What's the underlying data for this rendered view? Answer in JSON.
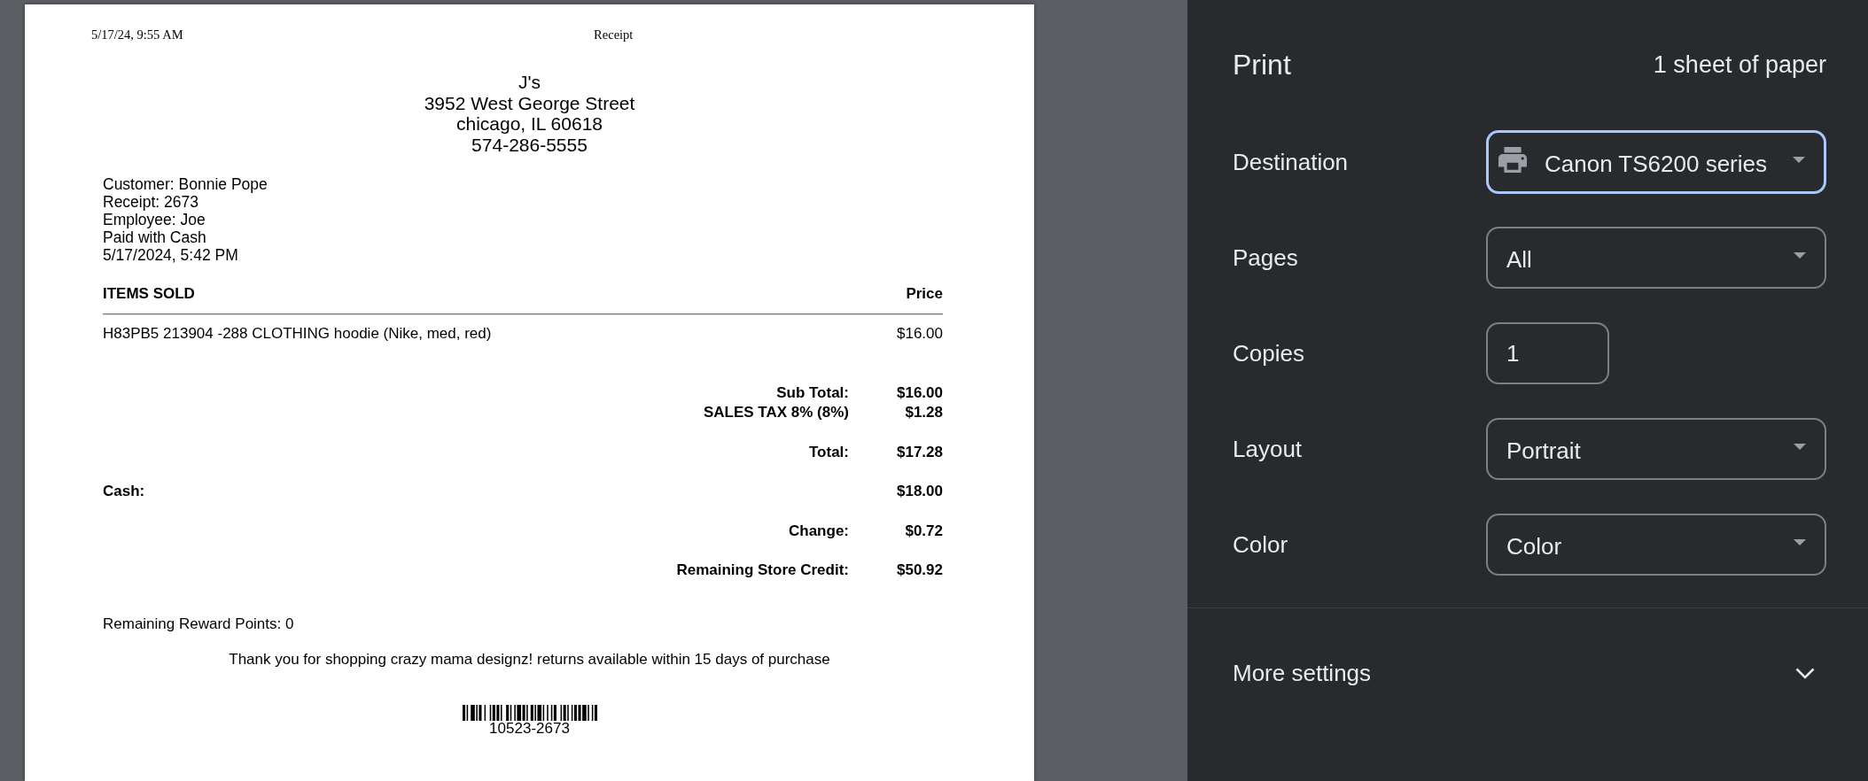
{
  "preview": {
    "page_header": {
      "date": "5/17/24, 9:55 AM",
      "title": "Receipt"
    },
    "store": {
      "name": "J's",
      "address_lines": [
        "3952 West George Street",
        "chicago, IL 60618"
      ],
      "phone": "574-286-5555"
    },
    "customer_details": [
      "Customer: Bonnie Pope",
      "Receipt: 2673",
      "Employee: Joe",
      "Paid with Cash",
      "5/17/2024, 5:42 PM"
    ],
    "items_table": {
      "columns": [
        "ITEMS SOLD",
        "Price"
      ],
      "rows": [
        {
          "description": "H83PB5 213904 -288 CLOTHING hoodie (Nike, med, red)",
          "price": "$16.00"
        }
      ]
    },
    "totals": [
      {
        "lines": [
          {
            "label": "Sub Total:",
            "value": "$16.00",
            "kind": "summary"
          },
          {
            "label": "SALES TAX 8% (8%)",
            "value": "$1.28",
            "kind": "summary"
          }
        ]
      },
      {
        "lines": [
          {
            "label": "Total:",
            "value": "$17.28",
            "kind": "summary"
          }
        ]
      },
      {
        "lines": [
          {
            "label": "Cash:",
            "value": "$18.00",
            "kind": "payment"
          }
        ]
      },
      {
        "lines": [
          {
            "label": "Change:",
            "value": "$0.72",
            "kind": "summary"
          }
        ]
      },
      {
        "lines": [
          {
            "label": "Remaining Store Credit:",
            "value": "$50.92",
            "kind": "summary"
          }
        ]
      }
    ],
    "reward_points": "Remaining Reward Points: 0",
    "thank_you_message": "Thank you for shopping crazy mama designz! returns available within 15 days of purchase",
    "barcode_number": "10523-2673"
  },
  "print_panel": {
    "title": "Print",
    "sheet_count": "1 sheet of paper",
    "settings": [
      {
        "label": "Destination",
        "kind": "destination",
        "value": "Canon TS6200 series",
        "focused": true
      },
      {
        "label": "Pages",
        "kind": "select",
        "value": "All",
        "focused": false
      },
      {
        "label": "Copies",
        "kind": "number",
        "value": "1",
        "focused": false
      },
      {
        "label": "Layout",
        "kind": "select",
        "value": "Portrait",
        "focused": false
      },
      {
        "label": "Color",
        "kind": "select",
        "value": "Color",
        "focused": false
      }
    ],
    "more_settings": {
      "label": "More settings",
      "expanded": false
    }
  }
}
